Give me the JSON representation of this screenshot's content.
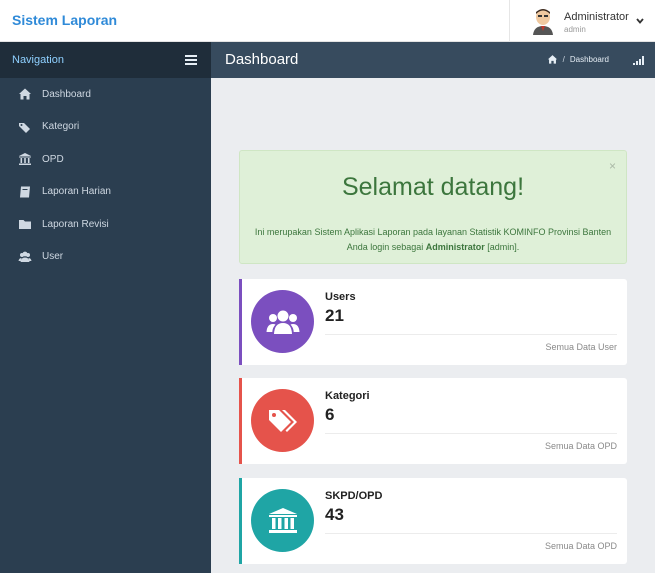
{
  "brand": {
    "title": "Sistem Laporan"
  },
  "user": {
    "name": "Administrator",
    "role": "admin"
  },
  "sidebar": {
    "title": "Navigation",
    "items": [
      {
        "label": "Dashboard",
        "icon": "home-icon"
      },
      {
        "label": "Kategori",
        "icon": "tags-icon"
      },
      {
        "label": "OPD",
        "icon": "institution-icon"
      },
      {
        "label": "Laporan Harian",
        "icon": "book-icon"
      },
      {
        "label": "Laporan Revisi",
        "icon": "folder-icon"
      },
      {
        "label": "User",
        "icon": "users-icon"
      }
    ]
  },
  "header": {
    "title": "Dashboard",
    "breadcrumb": {
      "separator": "/",
      "current": "Dashboard"
    }
  },
  "welcome": {
    "title": "Selamat datang!",
    "line1": "Ini merupakan Sistem Aplikasi Laporan pada layanan Statistik KOMINFO Provinsi Banten",
    "line2_prefix": "Anda login sebagai",
    "line2_name": "Administrator",
    "line2_suffix": "[admin].",
    "close": "×"
  },
  "cards": [
    {
      "title": "Users",
      "value": "21",
      "link": "Semua Data User",
      "color": "#7b4fbf"
    },
    {
      "title": "Kategori",
      "value": "6",
      "link": "Semua Data OPD",
      "color": "#e5534b"
    },
    {
      "title": "SKPD/OPD",
      "value": "43",
      "link": "Semua Data OPD",
      "color": "#1fa5a5"
    }
  ],
  "colors": {
    "brand": "#2f8ad8",
    "sidebar": "#2b3e50",
    "nav_head": "#1f2d3a",
    "header": "#374b5e",
    "alert_bg": "#dff0d8",
    "alert_text": "#3c763d"
  }
}
